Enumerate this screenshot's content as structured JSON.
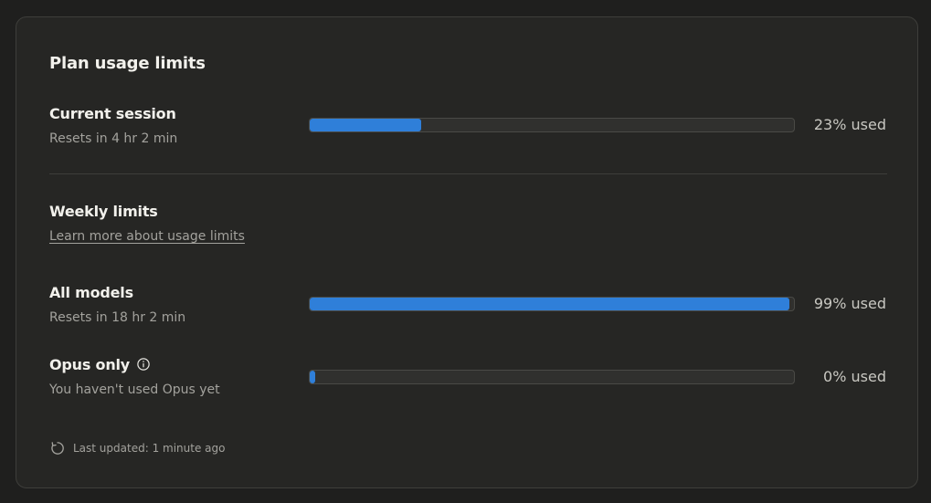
{
  "title": "Plan usage limits",
  "current_session": {
    "label": "Current session",
    "subtext": "Resets in 4 hr 2 min",
    "usage_percent": 23,
    "usage_text": "23% used"
  },
  "weekly": {
    "heading": "Weekly limits",
    "link_text": "Learn more about usage limits"
  },
  "all_models": {
    "label": "All models",
    "subtext": "Resets in 18 hr 2 min",
    "usage_percent": 99,
    "usage_text": "99% used"
  },
  "opus_only": {
    "label": "Opus only",
    "subtext": "You haven't used Opus yet",
    "usage_percent": 0,
    "usage_text": "0% used",
    "icon": "info-icon"
  },
  "footer": {
    "text": "Last updated: 1 minute ago",
    "icon": "refresh-icon"
  },
  "colors": {
    "bar_fill": "#2f7fd9",
    "background": "#262624"
  }
}
